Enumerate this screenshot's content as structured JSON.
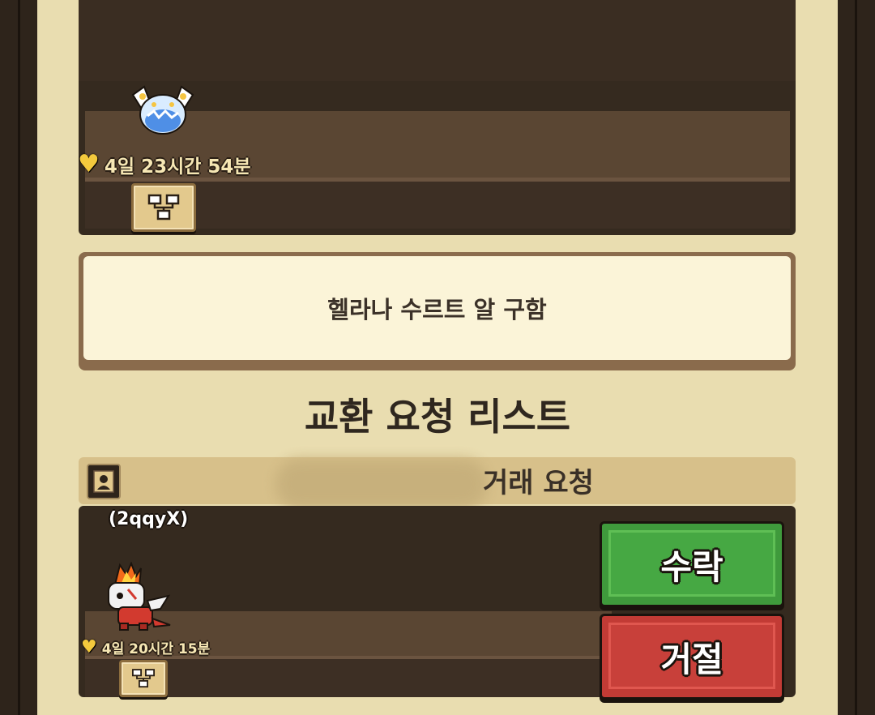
{
  "upper_listing": {
    "timer": "4일 23시간 54분",
    "heart_icon": "heart-icon",
    "tree_icon": "family-tree-icon",
    "item_icon": "winged-egg-icon"
  },
  "description": {
    "text": "헬라나 수르트 알 구함"
  },
  "section": {
    "title": "교환 요청 리스트"
  },
  "request": {
    "header_suffix": "거래 요청",
    "profile_icon": "profile-icon",
    "player_code": "(2qqyX)",
    "timer": "4일 20시간 15분",
    "pet_icon": "fire-dragon-icon",
    "accept_label": "수락",
    "reject_label": "거절"
  },
  "colors": {
    "panel_bg": "#e9ddb0",
    "card_bg": "#352a1f",
    "accept": "#46a843",
    "reject": "#c8403a",
    "timer_text": "#f6e7b4",
    "heart": "#f3c93d"
  }
}
